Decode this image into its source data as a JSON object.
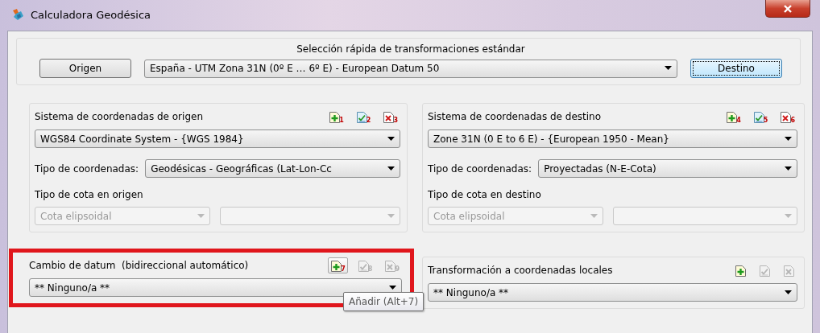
{
  "window": {
    "title": "Calculadora Geodésica"
  },
  "quick_selection": {
    "title": "Selección rápida de transformaciones estándar",
    "origin_button": {
      "label": "Origen",
      "focused": false
    },
    "preset": "España - UTM Zona 31N (0º E … 6º E) - European Datum 50",
    "destination_button": {
      "label": "Destino",
      "focused": true
    }
  },
  "panels": [
    {
      "title": "Sistema de coordenadas de origen",
      "tools": [
        {
          "kind": "add",
          "shortcut": "1",
          "disabled": false,
          "hovered": false
        },
        {
          "kind": "edit",
          "shortcut": "2",
          "disabled": false,
          "hovered": false
        },
        {
          "kind": "delete",
          "shortcut": "3",
          "disabled": false,
          "hovered": false
        }
      ],
      "system": "WGS84 Coordinate System - {WGS 1984}",
      "coord_type_label": "Tipo de coordenadas:",
      "coord_type": "Geodésicas - Geográficas (Lat-Lon-Cc",
      "height_title": "Tipo de cota en origen",
      "height_type": "Cota elipsoidal",
      "height_disabled": true
    },
    {
      "title": "Sistema de coordenadas de destino",
      "tools": [
        {
          "kind": "add",
          "shortcut": "4",
          "disabled": false,
          "hovered": false
        },
        {
          "kind": "edit",
          "shortcut": "5",
          "disabled": false,
          "hovered": false
        },
        {
          "kind": "delete",
          "shortcut": "6",
          "disabled": false,
          "hovered": false
        }
      ],
      "system": "Zone 31N (0 E to 6 E) - {European 1950 - Mean}",
      "coord_type_label": "Tipo de coordenadas:",
      "coord_type": "Proyectadas (N-E-Cota)",
      "height_title": "Tipo de cota en destino",
      "height_type": "Cota elipsoidal",
      "height_disabled": true
    }
  ],
  "bottom_panels": [
    {
      "title": "Cambio de datum  (bidireccional automático)",
      "tools": [
        {
          "kind": "add",
          "shortcut": "7",
          "disabled": false,
          "hovered": true
        },
        {
          "kind": "edit",
          "shortcut": "8",
          "disabled": true,
          "hovered": false
        },
        {
          "kind": "delete",
          "shortcut": "9",
          "disabled": true,
          "hovered": false
        }
      ],
      "value": "** Ninguno/a **",
      "highlighted": true,
      "tooltip": "Añadir (Alt+7)"
    },
    {
      "title": "Transformación a coordenadas locales",
      "tools": [
        {
          "kind": "add",
          "disabled": false,
          "hovered": false
        },
        {
          "kind": "edit",
          "disabled": true,
          "hovered": false
        },
        {
          "kind": "delete",
          "disabled": true,
          "hovered": false
        }
      ],
      "value": "** Ninguno/a **",
      "highlighted": false
    }
  ]
}
